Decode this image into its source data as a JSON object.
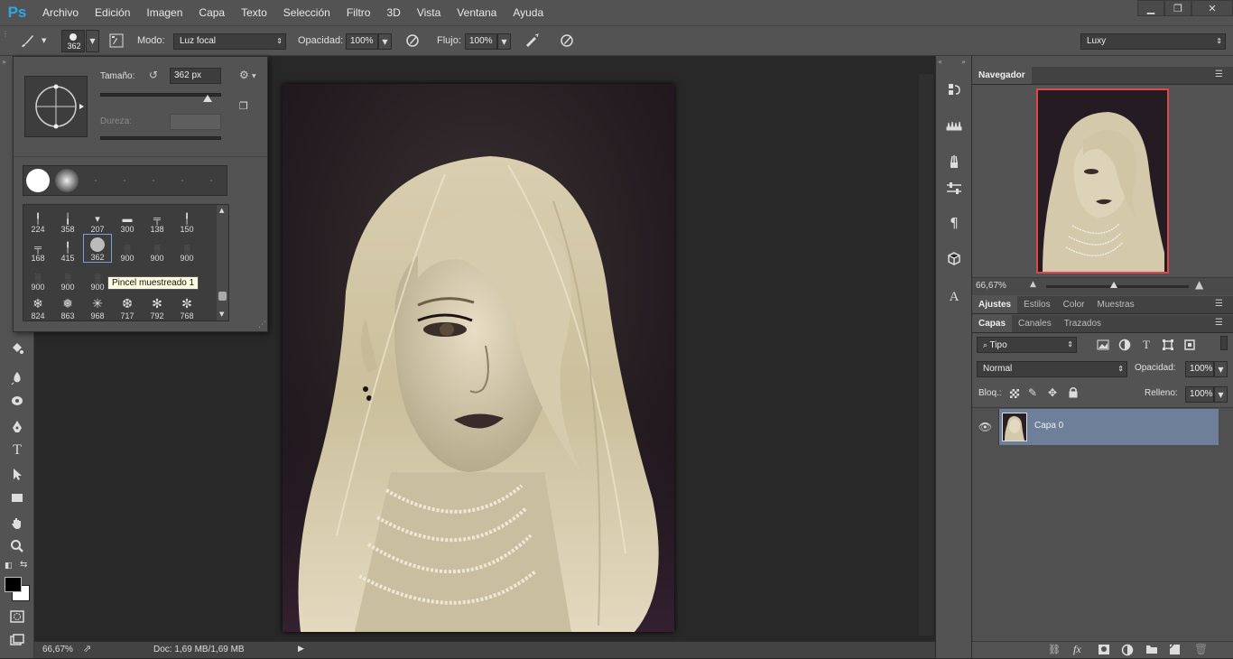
{
  "app": {
    "logo": "Ps"
  },
  "menu": [
    "Archivo",
    "Edición",
    "Imagen",
    "Capa",
    "Texto",
    "Selección",
    "Filtro",
    "3D",
    "Vista",
    "Ventana",
    "Ayuda"
  ],
  "window_controls": {
    "minimize": "▁",
    "restore": "❐",
    "close": "✕"
  },
  "options": {
    "brush_size": "362",
    "mode_label": "Modo:",
    "mode_value": "Luz focal",
    "opacity_label": "Opacidad:",
    "opacity_value": "100%",
    "flow_label": "Flujo:",
    "flow_value": "100%",
    "workspace": "Luxy"
  },
  "brush_popup": {
    "size_label": "Tamaño:",
    "size_value": "362 px",
    "hardness_label": "Dureza:",
    "size_slider_fraction": 0.89,
    "tooltip": "Pincel muestreado 1",
    "rows": [
      [
        "224",
        "358",
        "207",
        "300",
        "138",
        "150"
      ],
      [
        "168",
        "415",
        "362",
        "900",
        "900",
        "900"
      ],
      [
        "900",
        "900",
        "900",
        "",
        "",
        ""
      ],
      [
        "824",
        "863",
        "968",
        "717",
        "792",
        "768"
      ]
    ]
  },
  "status": {
    "zoom": "66,67%",
    "doc": "Doc: 1,69 MB/1,69 MB"
  },
  "navigator": {
    "title": "Navegador",
    "zoom": "66,67%"
  },
  "adjust_tabs": [
    "Ajustes",
    "Estilos",
    "Color",
    "Muestras"
  ],
  "layer_tabs": [
    "Capas",
    "Canales",
    "Trazados"
  ],
  "layers_panel": {
    "filter_kind": "Tipo",
    "blend_mode": "Normal",
    "opacity_label": "Opacidad:",
    "opacity_value": "100%",
    "lock_label": "Bloq.:",
    "fill_label": "Relleno:",
    "fill_value": "100%",
    "layers": [
      {
        "name": "Capa 0",
        "visible": true,
        "selected": true
      }
    ]
  },
  "colors": {
    "accent": "#2aa6e6",
    "selected_layer": "#6d7f99",
    "nav_frame": "#e0474c"
  }
}
